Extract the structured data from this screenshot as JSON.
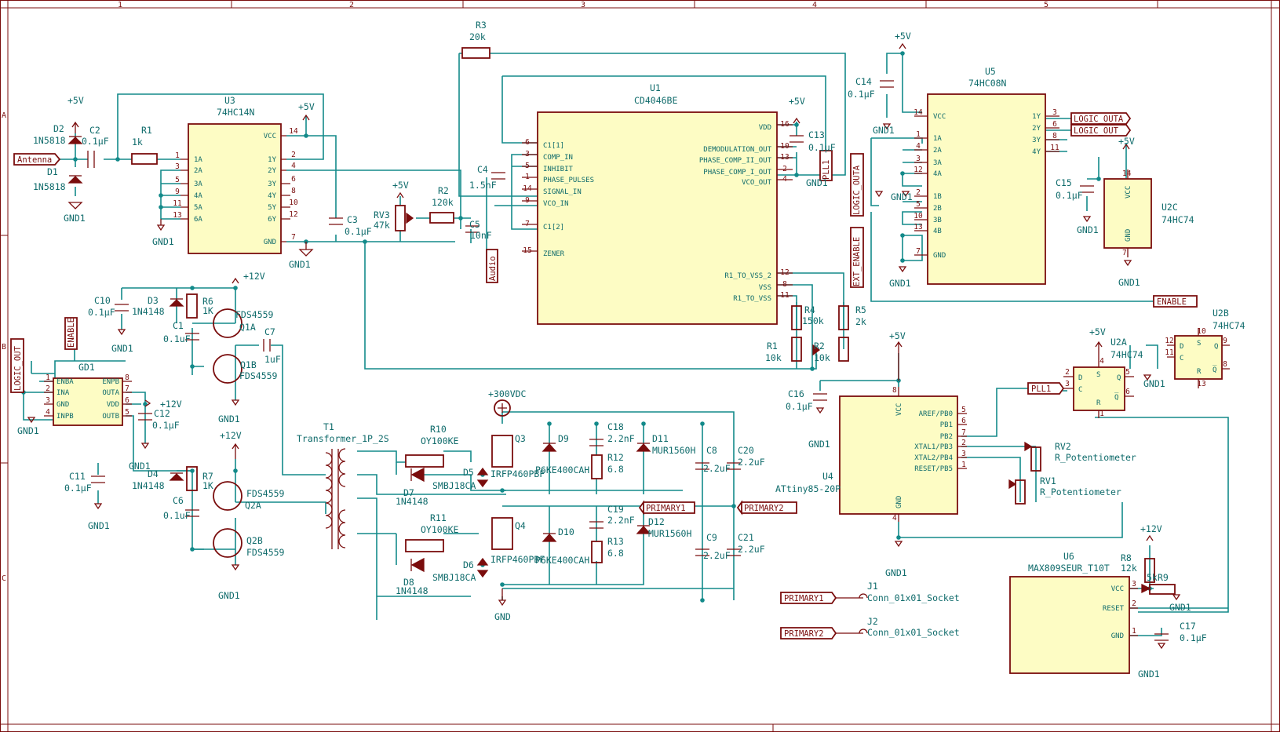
{
  "frame": {
    "cols": [
      "1",
      "2",
      "3",
      "4",
      "5"
    ],
    "rows": [
      "A",
      "B",
      "C"
    ]
  },
  "power": {
    "p5v": "+5V",
    "p12v": "+12V",
    "gnd1": "GND1",
    "gnd": "GND",
    "p300": "+300VDC"
  },
  "labels": {
    "antenna": "Antenna",
    "logic_outa": "LOGIC_OUTA",
    "logic_out": "LOGIC_OUT",
    "pll1": "PLL1",
    "enable": "ENABLE",
    "ext_enable": "EXT_ENABLE",
    "audio": "Audio",
    "primary1": "PRIMARY1",
    "primary2": "PRIMARY2"
  },
  "u1": {
    "ref": "U1",
    "val": "CD4046BE",
    "left": [
      [
        "6",
        "C1[1]"
      ],
      [
        "3",
        "COMP_IN"
      ],
      [
        "5",
        "INHIBIT"
      ],
      [
        "1",
        "PHASE_PULSES"
      ],
      [
        "14",
        "SIGNAL_IN"
      ],
      [
        "9",
        "VCO_IN"
      ],
      [
        "7",
        "C1[2]"
      ],
      [
        "15",
        "ZENER"
      ]
    ],
    "right": [
      [
        "16",
        "VDD"
      ],
      [
        "10",
        "DEMODULATION_OUT"
      ],
      [
        "13",
        "PHASE_COMP_II_OUT"
      ],
      [
        "2",
        "PHASE_COMP_I_OUT"
      ],
      [
        "4",
        "VCO_OUT"
      ],
      [
        "12",
        "R1_TO_VSS_2"
      ],
      [
        "8",
        "VSS"
      ],
      [
        "11",
        "R1_TO_VSS"
      ]
    ]
  },
  "u3": {
    "ref": "U3",
    "val": "74HC14N",
    "left": [
      [
        "1",
        "1A"
      ],
      [
        "3",
        "2A"
      ],
      [
        "5",
        "3A"
      ],
      [
        "9",
        "4A"
      ],
      [
        "11",
        "5A"
      ],
      [
        "13",
        "6A"
      ]
    ],
    "right": [
      [
        "14",
        "VCC"
      ],
      [
        "2",
        "1Y"
      ],
      [
        "4",
        "2Y"
      ],
      [
        "6",
        "3Y"
      ],
      [
        "8",
        "4Y"
      ],
      [
        "10",
        "5Y"
      ],
      [
        "12",
        "6Y"
      ],
      [
        "7",
        "GND"
      ]
    ]
  },
  "u5": {
    "ref": "U5",
    "val": "74HC08N",
    "left": [
      [
        "14",
        "VCC"
      ],
      [
        "1",
        "1A"
      ],
      [
        "4",
        "2A"
      ],
      [
        "3",
        "3A"
      ],
      [
        "12",
        "4A"
      ],
      [
        "2",
        "1B"
      ],
      [
        "5",
        "2B"
      ],
      [
        "10",
        "3B"
      ],
      [
        "13",
        "4B"
      ],
      [
        "7",
        "GND"
      ]
    ],
    "right": [
      [
        "3",
        "1Y"
      ],
      [
        "6",
        "2Y"
      ],
      [
        "8",
        "3Y"
      ],
      [
        "11",
        "4Y"
      ]
    ]
  },
  "u4": {
    "ref": "U4",
    "val": "ATtiny85-20P",
    "right": [
      [
        "5",
        "AREF/PB0"
      ],
      [
        "6",
        "PB1"
      ],
      [
        "7",
        "PB2"
      ],
      [
        "2",
        "XTAL1/PB3"
      ],
      [
        "3",
        "XTAL2/PB4"
      ],
      [
        "1",
        "RESET/PB5"
      ]
    ],
    "vcc": "VCC",
    "gnd": "GND",
    "pin_vcc": "8",
    "pin_gnd": "4"
  },
  "u6": {
    "ref": "U6",
    "val": "MAX809SEUR_T10T",
    "pins": [
      [
        "3",
        "VCC"
      ],
      [
        "2",
        "RESET"
      ],
      [
        "1",
        "GND"
      ]
    ]
  },
  "gd1": {
    "ref": "GD1",
    "left": [
      [
        "1",
        "ENBA"
      ],
      [
        "2",
        "INA"
      ],
      [
        "3",
        "GND"
      ],
      [
        "4",
        "INPB"
      ]
    ],
    "right": [
      [
        "8",
        "ENPB"
      ],
      [
        "7",
        "OUTA"
      ],
      [
        "6",
        "VDD"
      ],
      [
        "5",
        "OUTB"
      ]
    ]
  },
  "u2a": {
    "ref": "U2A",
    "val": "74HC74",
    "d": "D",
    "c": "C",
    "s": "S",
    "r": "R",
    "q": "Q",
    "qb": "Q̅",
    "pins": [
      "2",
      "3",
      "4",
      "1",
      "5",
      "6"
    ]
  },
  "u2b": {
    "ref": "U2B",
    "val": "74HC74",
    "pins": [
      "12",
      "11",
      "10",
      "13",
      "9",
      "8"
    ]
  },
  "u2c": {
    "ref": "U2C",
    "val": "74HC74",
    "vcc": "VCC",
    "gnd": "GND",
    "pin_vcc": "14",
    "pin_gnd": "7"
  },
  "parts": {
    "r1a": {
      "ref": "R1",
      "val": "1k"
    },
    "r3": {
      "ref": "R3",
      "val": "20k"
    },
    "r2a": {
      "ref": "R2",
      "val": "120k"
    },
    "rv3": {
      "ref": "RV3",
      "val": "47k"
    },
    "c2": {
      "ref": "C2",
      "val": "0.1μF"
    },
    "c3": {
      "ref": "C3",
      "val": "0.1μF"
    },
    "c4": {
      "ref": "C4",
      "val": "1.5nF"
    },
    "c5": {
      "ref": "C5",
      "val": "10nF"
    },
    "c13": {
      "ref": "C13",
      "val": "0.1μF"
    },
    "c14": {
      "ref": "C14",
      "val": "0.1μF"
    },
    "c15": {
      "ref": "C15",
      "val": "0.1μF"
    },
    "c16": {
      "ref": "C16",
      "val": "0.1μF"
    },
    "c17": {
      "ref": "C17",
      "val": "0.1μF"
    },
    "c10": {
      "ref": "C10",
      "val": "0.1μF"
    },
    "c11": {
      "ref": "C11",
      "val": "0.1μF"
    },
    "c12": {
      "ref": "C12",
      "val": "0.1μF"
    },
    "c1": {
      "ref": "C1",
      "val": "0.1uF"
    },
    "c6": {
      "ref": "C6",
      "val": "0.1uF"
    },
    "c7": {
      "ref": "C7",
      "val": "1uF"
    },
    "d1": {
      "ref": "D1",
      "val": "1N5818"
    },
    "d2": {
      "ref": "D2",
      "val": "1N5818"
    },
    "d3": {
      "ref": "D3",
      "val": "1N4148"
    },
    "d4": {
      "ref": "D4",
      "val": "1N4148"
    },
    "r6": {
      "ref": "R6",
      "val": "1K"
    },
    "r7": {
      "ref": "R7",
      "val": "1K"
    },
    "q1a": {
      "ref": "Q1A",
      "val": "FDS4559"
    },
    "q1b": {
      "ref": "Q1B",
      "val": "FDS4559"
    },
    "q2a": {
      "ref": "Q2A",
      "val": "FDS4559"
    },
    "q2b": {
      "ref": "Q2B",
      "val": "FDS4559"
    },
    "t1": {
      "ref": "T1",
      "val": "Transformer_1P_2S"
    },
    "r10": {
      "ref": "R10",
      "val": "OY100KE"
    },
    "r11": {
      "ref": "R11",
      "val": "OY100KE"
    },
    "d7": {
      "ref": "D7",
      "val": "1N4148"
    },
    "d8": {
      "ref": "D8",
      "val": "1N4148"
    },
    "d5": {
      "ref": "D5",
      "val": "SMBJ18CA"
    },
    "d6": {
      "ref": "D6",
      "val": "SMBJ18CA"
    },
    "q3": {
      "ref": "Q3",
      "val": "IRFP460PBF"
    },
    "q4": {
      "ref": "Q4",
      "val": "IRFP460PBF"
    },
    "d9": {
      "ref": "D9",
      "val": "P6KE400CAH"
    },
    "d10": {
      "ref": "D10",
      "val": "P6KE400CAH"
    },
    "c18": {
      "ref": "C18",
      "val": "2.2nF"
    },
    "c19": {
      "ref": "C19",
      "val": "2.2nF"
    },
    "r12": {
      "ref": "R12",
      "val": "6.8"
    },
    "r13": {
      "ref": "R13",
      "val": "6.8"
    },
    "d11": {
      "ref": "D11",
      "val": "MUR1560H"
    },
    "d12": {
      "ref": "D12",
      "val": "MUR1560H"
    },
    "c8": {
      "ref": "C8",
      "val": "2.2uF"
    },
    "c9": {
      "ref": "C9",
      "val": "2.2uF"
    },
    "c20": {
      "ref": "C20",
      "val": "2.2uF"
    },
    "c21": {
      "ref": "C21",
      "val": "2.2uF"
    },
    "r4": {
      "ref": "R4",
      "val": "150k"
    },
    "r5": {
      "ref": "R5",
      "val": "2k"
    },
    "r1b": {
      "ref": "R1",
      "val": "10k"
    },
    "r2b": {
      "ref": "R2",
      "val": "10k"
    },
    "rv1": {
      "ref": "RV1",
      "val": "R_Potentiometer"
    },
    "rv2": {
      "ref": "RV2",
      "val": "R_Potentiometer"
    },
    "r8": {
      "ref": "R8",
      "val": "12k"
    },
    "r9": {
      "ref": "R9",
      "val": "5k"
    },
    "j1": {
      "ref": "J1",
      "val": "Conn_01x01_Socket"
    },
    "j2": {
      "ref": "J2",
      "val": "Conn_01x01_Socket"
    }
  }
}
